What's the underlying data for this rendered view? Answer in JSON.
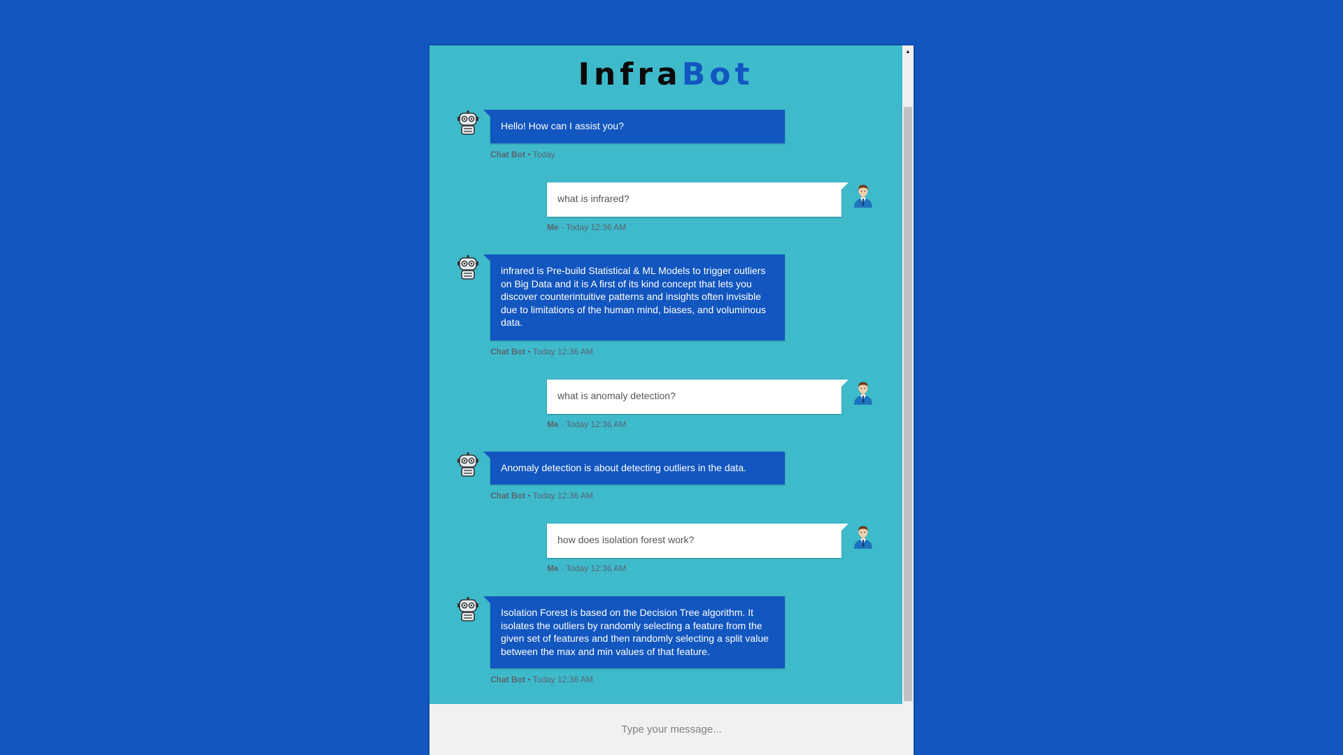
{
  "app": {
    "title_part1": "Infra",
    "title_part2": "Bot"
  },
  "messages": [
    {
      "sender": "Chat Bot",
      "text": "Hello! How can I assist you?",
      "sep": " • ",
      "time": "Today"
    },
    {
      "sender": "Me",
      "text": "what is infrared?",
      "sep": " · ",
      "time": "Today 12:36 AM"
    },
    {
      "sender": "Chat Bot",
      "text": "infrared is Pre-build Statistical & ML Models to trigger outliers on Big Data and it is A first of its kind concept that lets you discover counterintuitive patterns and insights often invisible due to limitations of the human mind, biases, and voluminous data.",
      "sep": " • ",
      "time": "Today 12:36 AM"
    },
    {
      "sender": "Me",
      "text": "what is anomaly detection?",
      "sep": " · ",
      "time": "Today 12:36 AM"
    },
    {
      "sender": "Chat Bot",
      "text": "Anomaly detection is about detecting outliers in the data.",
      "sep": " • ",
      "time": "Today 12:36 AM"
    },
    {
      "sender": "Me",
      "text": "how does isolation forest work?",
      "sep": " · ",
      "time": "Today 12:36 AM"
    },
    {
      "sender": "Chat Bot",
      "text": "Isolation Forest is based on the Decision Tree algorithm. It isolates the outliers by randomly selecting a feature from the given set of features and then randomly selecting a split value between the max and min values of that feature.",
      "sep": " • ",
      "time": "Today 12:36 AM"
    }
  ],
  "input": {
    "placeholder": "Type your message..."
  },
  "icons": {
    "bot_avatar": "robot-icon",
    "user_avatar": "businessman-icon",
    "scroll_up": "scroll-up-arrow-icon"
  },
  "colors": {
    "page_background": "#1256c0",
    "chat_background": "#3ebacb",
    "bot_bubble": "#1256c0",
    "user_bubble": "#ffffff",
    "title_accent": "#1256c0"
  }
}
